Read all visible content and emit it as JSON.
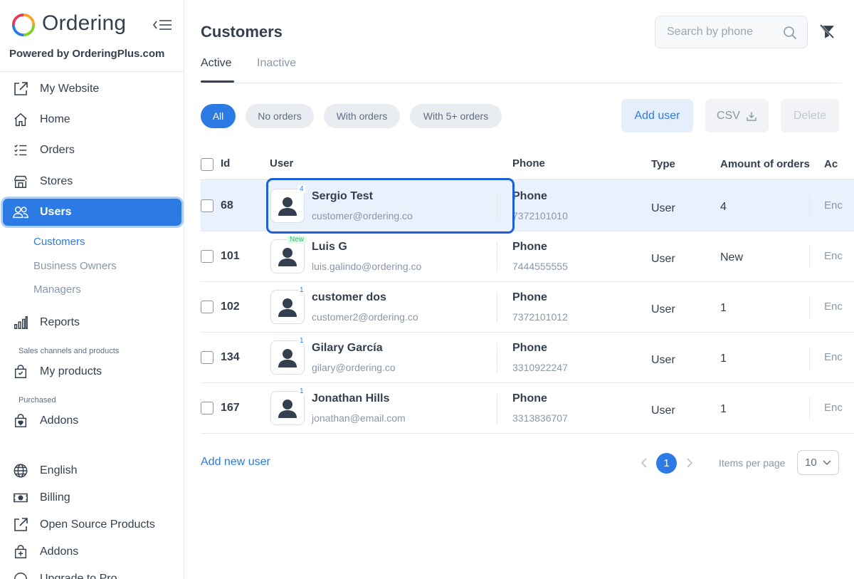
{
  "brand": {
    "name": "Ordering",
    "powered_by": "Powered by OrderingPlus.com"
  },
  "sidebar": {
    "items": [
      {
        "label": "My Website",
        "icon": "external-link-icon"
      },
      {
        "label": "Home",
        "icon": "home-icon"
      },
      {
        "label": "Orders",
        "icon": "list-check-icon"
      },
      {
        "label": "Stores",
        "icon": "shop-icon"
      },
      {
        "label": "Users",
        "icon": "users-icon",
        "active": true
      }
    ],
    "users_sub": [
      "Customers",
      "Business Owners",
      "Managers"
    ],
    "reports": "Reports",
    "sales_caption": "Sales channels and products",
    "my_products": "My products",
    "purchased_caption": "Purchased",
    "addons": "Addons",
    "bottom": [
      {
        "label": "English",
        "icon": "globe-icon"
      },
      {
        "label": "Billing",
        "icon": "cash-icon"
      },
      {
        "label": "Open Source Products",
        "icon": "external-link-icon"
      },
      {
        "label": "Addons",
        "icon": "bag-plus-icon"
      },
      {
        "label": "Upgrade to Pro",
        "icon": "circle-icon"
      }
    ]
  },
  "main": {
    "title": "Customers",
    "search_placeholder": "Search by phone",
    "tabs": [
      "Active",
      "Inactive"
    ],
    "filters": [
      "All",
      "No orders",
      "With orders",
      "With 5+ orders"
    ],
    "buttons": {
      "add_user": "Add user",
      "csv": "CSV",
      "delete": "Delete"
    },
    "columns": [
      "Id",
      "User",
      "Phone",
      "Type",
      "Amount of orders",
      "Ac"
    ],
    "rows": [
      {
        "id": "68",
        "name": "Sergio Test",
        "email": "customer@ordering.co",
        "phone_label": "Phone",
        "phone": "7372101010",
        "type": "User",
        "orders": "4",
        "badge": "4",
        "action": "Enc"
      },
      {
        "id": "101",
        "name": "Luis G",
        "email": "luis.galindo@ordering.co",
        "phone_label": "Phone",
        "phone": "7444555555",
        "type": "User",
        "orders": "New",
        "badge": "New",
        "action": "Enc"
      },
      {
        "id": "102",
        "name": "customer dos",
        "email": "customer2@ordering.co",
        "phone_label": "Phone",
        "phone": "7372101012",
        "type": "User",
        "orders": "1",
        "badge": "1",
        "action": "Enc"
      },
      {
        "id": "134",
        "name": "Gilary García",
        "email": "gilary@ordering.co",
        "phone_label": "Phone",
        "phone": "3310922247",
        "type": "User",
        "orders": "1",
        "badge": "1",
        "action": "Enc"
      },
      {
        "id": "167",
        "name": "Jonathan Hills",
        "email": "jonathan@email.com",
        "phone_label": "Phone",
        "phone": "3313836707",
        "type": "User",
        "orders": "1",
        "badge": "1",
        "action": "Enc"
      }
    ],
    "add_new_user": "Add new user",
    "pagination": {
      "current": "1",
      "items_per_page_label": "Items per page",
      "items_per_page": "10"
    }
  },
  "colors": {
    "accent": "#2c7be5",
    "text": "#344050",
    "muted": "#8a97a8",
    "selected_row": "#e8f1fc",
    "highlight": "#1d5fd6"
  }
}
